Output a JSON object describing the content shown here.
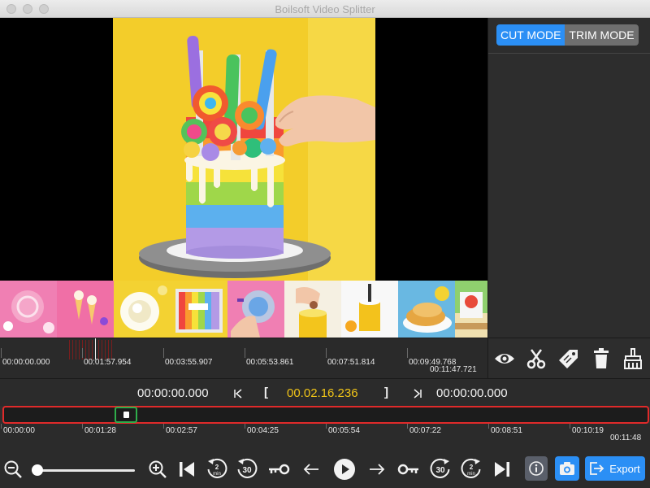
{
  "window": {
    "title": "Boilsoft Video Splitter"
  },
  "modes": {
    "cut": "CUT MODE",
    "trim": "TRIM MODE"
  },
  "top_ruler": {
    "labels": [
      "00:00:00.000",
      "00:01:57.954",
      "00:03:55.907",
      "00:05:53.861",
      "00:07:51.814",
      "00:09:49.768"
    ],
    "end_label": "00:11:47.721"
  },
  "tools": [
    "eye-icon",
    "scissors-icon",
    "tag-icon",
    "trash-icon",
    "broom-icon"
  ],
  "time_row": {
    "start": "00:00:00.000",
    "current": "00.02.16.236",
    "end": "00:00:00.000",
    "bracket_open": "[",
    "bracket_close": "]"
  },
  "main_ruler": {
    "labels": [
      "00:00:00",
      "00:01:28",
      "00:02:57",
      "00:04:25",
      "00:05:54",
      "00:07:22",
      "00:08:51",
      "00:10:19"
    ],
    "end_label": "00:11:48"
  },
  "controls": {
    "zoom_level": 0,
    "rewind_2min": "2 min",
    "rewind_30": "30",
    "forward_30": "30",
    "forward_2min": "2 min",
    "export_label": "Export"
  },
  "colors": {
    "accent": "#2b8ff5",
    "current_time": "#f0c418",
    "timeline_border": "#e02a2a",
    "handle_border": "#2fae4b"
  }
}
